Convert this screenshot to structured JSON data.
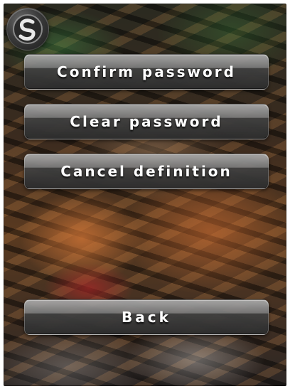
{
  "header": {
    "logo_icon": "app-logo-icon"
  },
  "menu": {
    "confirm_password": "Confirm password",
    "clear_password": "Clear password",
    "cancel_definition": "Cancel definition",
    "back": "Back"
  },
  "theme": {
    "button_text_color": "#ffffff",
    "button_dark": "#2d2d2d",
    "button_light": "#aaaaaa"
  }
}
